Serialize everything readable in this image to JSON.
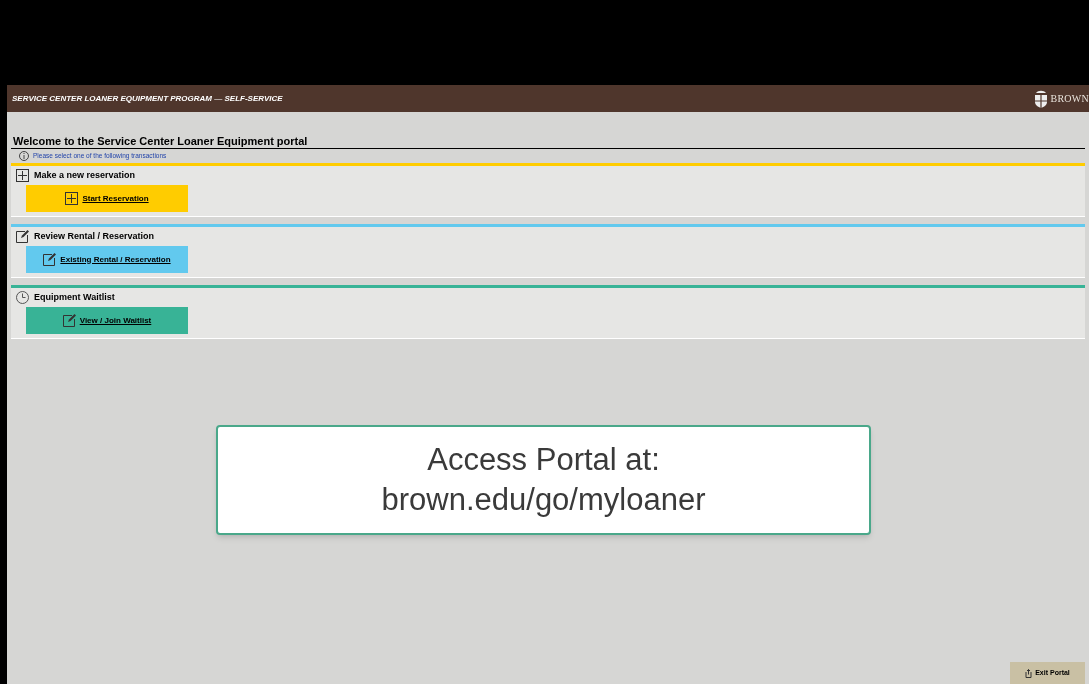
{
  "header": {
    "title": "SERVICE CENTER LOANER EQUIPMENT PROGRAM — SELF-SERVICE",
    "logo_text": "BROWN"
  },
  "page": {
    "heading": "Welcome to the Service Center Loaner Equipment portal",
    "info": "Please select one of the following transactions"
  },
  "sections": [
    {
      "kind": "create",
      "title": "Make a new reservation",
      "color": "#ffcc00",
      "button": {
        "label": "Start Reservation"
      }
    },
    {
      "kind": "review",
      "title": "Review Rental / Reservation",
      "color": "#62c9ee",
      "button": {
        "label": "Existing Rental / Reservation"
      }
    },
    {
      "kind": "waitlist",
      "title": "Equipment Waitlist",
      "color": "#38b396",
      "button": {
        "label": "View / Join Waitlist"
      }
    }
  ],
  "overlay": {
    "lines": [
      "Access Portal at:",
      "brown.edu/go/myloaner"
    ]
  },
  "footer": {
    "button": "Exit Portal"
  }
}
